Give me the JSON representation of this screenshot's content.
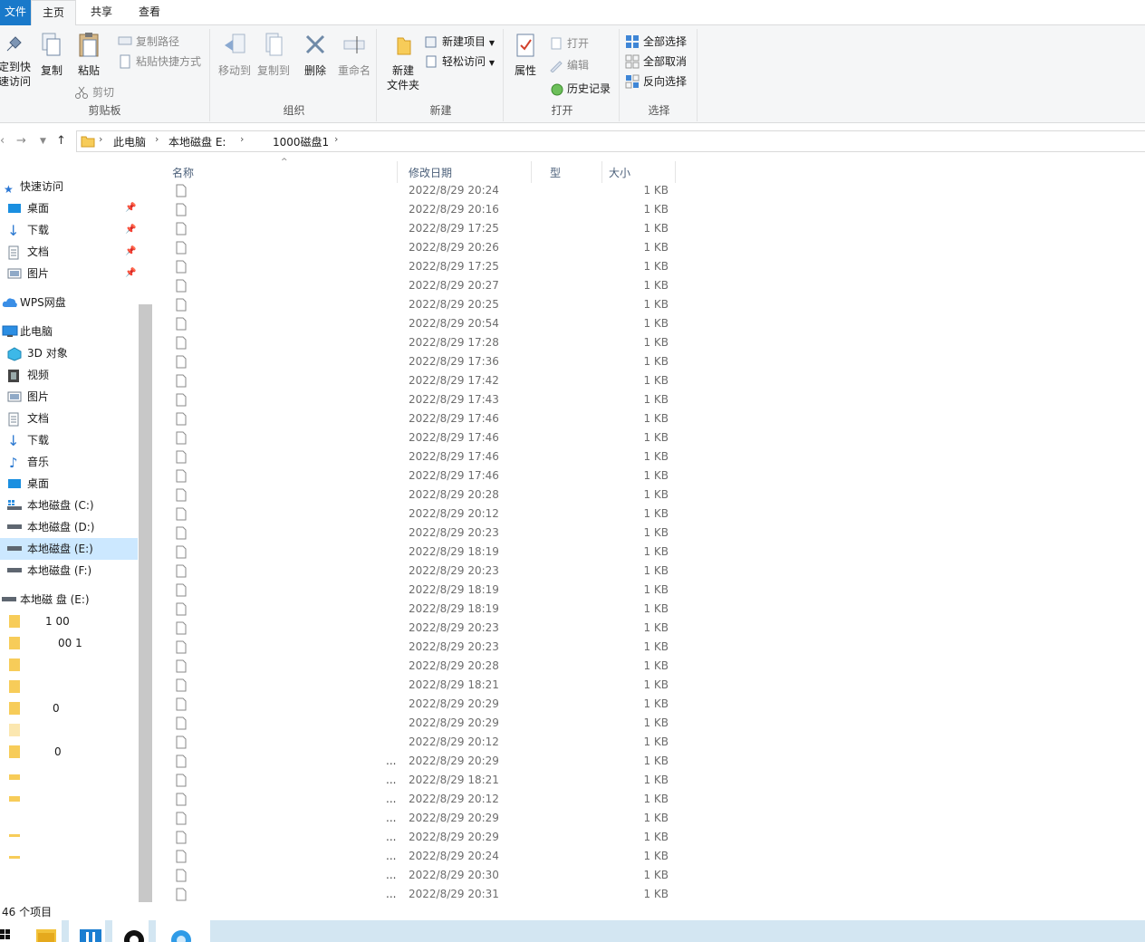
{
  "tabs": {
    "file": "文件",
    "home": "主页",
    "share": "共享",
    "view": "查看"
  },
  "ribbon": {
    "clipboard": {
      "pin_label_1": "定到快",
      "pin_label_2": "速访问",
      "copy": "复制",
      "paste": "粘贴",
      "copy_path": "复制路径",
      "paste_shortcut": "粘贴快捷方式",
      "cut": "剪切",
      "label": "剪贴板"
    },
    "organize": {
      "move_to": "移动到",
      "copy_to": "复制到",
      "delete": "删除",
      "rename": "重命名",
      "label": "组织"
    },
    "new": {
      "new_folder_1": "新建",
      "new_folder_2": "文件夹",
      "new_item": "新建项目",
      "easy_access": "轻松访问",
      "label": "新建"
    },
    "open": {
      "properties": "属性",
      "open": "打开",
      "edit": "编辑",
      "history": "历史记录",
      "label": "打开"
    },
    "select": {
      "select_all": "全部选择",
      "select_none": "全部取消",
      "invert": "反向选择",
      "label": "选择"
    }
  },
  "address": {
    "crumbs": [
      "此电脑",
      "本地磁盘 E:",
      "1000磁盘1"
    ]
  },
  "nav_pane": {
    "quick_access": "快速访问",
    "quick_items": [
      "桌面",
      "下载",
      "文档",
      "图片"
    ],
    "wps": "WPS网盘",
    "this_pc": "此电脑",
    "pc_items": [
      "3D 对象",
      "视频",
      "图片",
      "文档",
      "下载",
      "音乐",
      "桌面"
    ],
    "drives": [
      "本地磁盘 (C:)",
      "本地磁盘 (D:)",
      "本地磁盘 (E:)",
      "本地磁盘 (F:)"
    ],
    "drive_e_tree": "本地磁 盘 (E:)",
    "sub_folders": [
      "1 00",
      "00 1",
      "",
      "",
      "0",
      "",
      "0"
    ]
  },
  "columns": {
    "name": "名称",
    "date": "修改日期",
    "type": "型",
    "size": "大小"
  },
  "files": [
    {
      "date": "2022/8/29 20:24",
      "size": "1 KB"
    },
    {
      "date": "2022/8/29 20:16",
      "size": "1 KB"
    },
    {
      "date": "2022/8/29 17:25",
      "size": "1 KB"
    },
    {
      "date": "2022/8/29 20:26",
      "size": "1 KB"
    },
    {
      "date": "2022/8/29 17:25",
      "size": "1 KB"
    },
    {
      "date": "2022/8/29 20:27",
      "size": "1 KB"
    },
    {
      "date": "2022/8/29 20:25",
      "size": "1 KB"
    },
    {
      "date": "2022/8/29 20:54",
      "size": "1 KB"
    },
    {
      "date": "2022/8/29 17:28",
      "size": "1 KB"
    },
    {
      "date": "2022/8/29 17:36",
      "size": "1 KB"
    },
    {
      "date": "2022/8/29 17:42",
      "size": "1 KB"
    },
    {
      "date": "2022/8/29 17:43",
      "size": "1 KB"
    },
    {
      "date": "2022/8/29 17:46",
      "size": "1 KB"
    },
    {
      "date": "2022/8/29 17:46",
      "size": "1 KB"
    },
    {
      "date": "2022/8/29 17:46",
      "size": "1 KB"
    },
    {
      "date": "2022/8/29 17:46",
      "size": "1 KB"
    },
    {
      "date": "2022/8/29 20:28",
      "size": "1 KB"
    },
    {
      "date": "2022/8/29 20:12",
      "size": "1 KB"
    },
    {
      "date": "2022/8/29 20:23",
      "size": "1 KB"
    },
    {
      "date": "2022/8/29 18:19",
      "size": "1 KB"
    },
    {
      "date": "2022/8/29 20:23",
      "size": "1 KB"
    },
    {
      "date": "2022/8/29 18:19",
      "size": "1 KB"
    },
    {
      "date": "2022/8/29 18:19",
      "size": "1 KB"
    },
    {
      "date": "2022/8/29 20:23",
      "size": "1 KB"
    },
    {
      "date": "2022/8/29 20:23",
      "size": "1 KB"
    },
    {
      "date": "2022/8/29 20:28",
      "size": "1 KB"
    },
    {
      "date": "2022/8/29 18:21",
      "size": "1 KB"
    },
    {
      "date": "2022/8/29 20:29",
      "size": "1 KB"
    },
    {
      "date": "2022/8/29 20:29",
      "size": "1 KB"
    },
    {
      "date": "2022/8/29 20:12",
      "size": "1 KB"
    },
    {
      "date": "2022/8/29 20:29",
      "size": "1 KB"
    },
    {
      "date": "2022/8/29 18:21",
      "size": "1 KB"
    },
    {
      "date": "2022/8/29 20:12",
      "size": "1 KB"
    },
    {
      "date": "2022/8/29 20:29",
      "size": "1 KB"
    },
    {
      "date": "2022/8/29 20:29",
      "size": "1 KB"
    },
    {
      "date": "2022/8/29 20:24",
      "size": "1 KB"
    },
    {
      "date": "2022/8/29 20:30",
      "size": "1 KB"
    },
    {
      "date": "2022/8/29 20:31",
      "size": "1 KB"
    }
  ],
  "dots_text": "...",
  "status": {
    "count": "46 个项目"
  }
}
